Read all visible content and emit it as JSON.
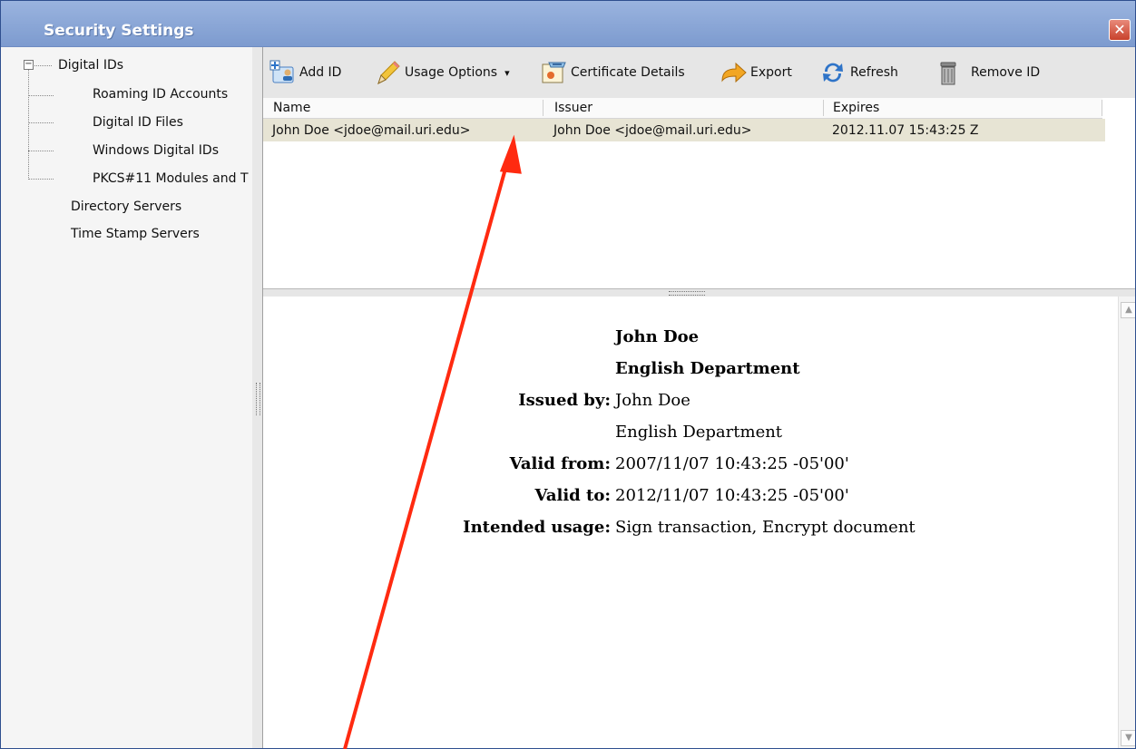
{
  "window": {
    "title": "Security Settings",
    "close_glyph": "✕"
  },
  "sidebar": {
    "items": [
      {
        "label": "Digital IDs",
        "expander": "−"
      },
      {
        "label": "Roaming ID Accounts"
      },
      {
        "label": "Digital ID Files"
      },
      {
        "label": "Windows Digital IDs"
      },
      {
        "label": "PKCS#11 Modules and T"
      },
      {
        "label": "Directory Servers"
      },
      {
        "label": "Time Stamp Servers"
      }
    ]
  },
  "toolbar": {
    "add_id": "Add ID",
    "usage_options": "Usage Options",
    "usage_dropdown_glyph": "▾",
    "certificate_details": "Certificate Details",
    "export": "Export",
    "refresh": "Refresh",
    "remove_id": "Remove ID"
  },
  "list": {
    "columns": [
      "Name",
      "Issuer",
      "Expires"
    ],
    "rows": [
      {
        "name": "John Doe <jdoe@mail.uri.edu>",
        "issuer": "John Doe <jdoe@mail.uri.edu>",
        "expires": "2012.11.07 15:43:25 Z"
      }
    ]
  },
  "details": {
    "subject_name": "John Doe",
    "subject_org": "English Department",
    "issued_by_label": "Issued by:",
    "issued_by_name": "John Doe",
    "issued_by_org": "English Department",
    "valid_from_label": "Valid from:",
    "valid_from": "2007/11/07 10:43:25 -05'00'",
    "valid_to_label": "Valid to:",
    "valid_to": "2012/11/07 10:43:25 -05'00'",
    "intended_usage_label": "Intended usage:",
    "intended_usage": "Sign transaction, Encrypt document"
  },
  "colors": {
    "title_bar": "#8aa6d6",
    "selected_row": "#e7e4d4",
    "annotation_arrow": "#ff2a10"
  },
  "icons": {
    "add_id": "add-id-icon",
    "usage": "pencil-icon",
    "certificate": "certificate-icon",
    "export": "export-arrow-icon",
    "refresh": "refresh-icon",
    "remove": "trash-icon"
  }
}
